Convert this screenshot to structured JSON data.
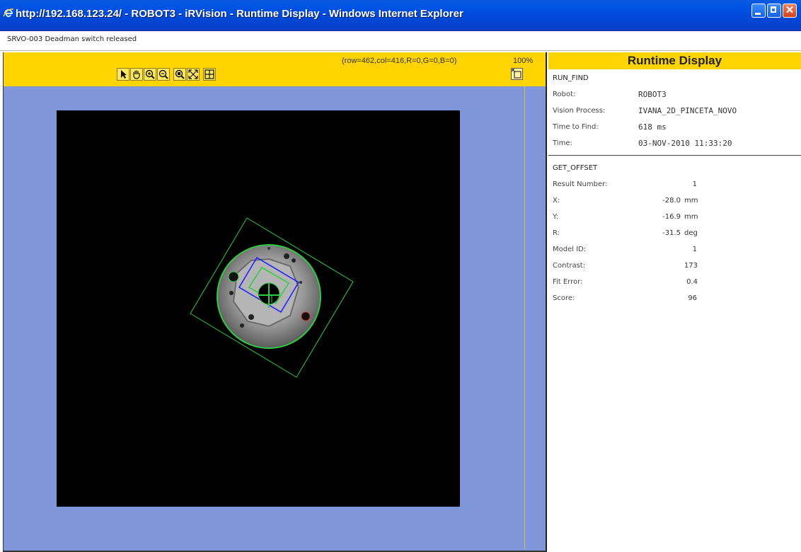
{
  "window": {
    "title": "http://192.168.123.24/ - ROBOT3 - iRVision - Runtime Display - Windows Internet Explorer"
  },
  "status": {
    "message": "SRVO-003 Deadman switch released"
  },
  "image_panel": {
    "coord_readout": "(row=462,col=416,R=0,G=0,B=0)",
    "zoom": "100%",
    "tools": [
      "pointer-icon",
      "pan-hand-icon",
      "zoom-in-icon",
      "zoom-out-icon",
      "zoom-region-icon",
      "fit-to-window-icon",
      "grid-icon"
    ]
  },
  "runtime": {
    "title": "Runtime Display",
    "run_find": {
      "section": "RUN_FIND",
      "rows": [
        {
          "label": "Robot:",
          "value": "ROBOT3"
        },
        {
          "label": "Vision Process:",
          "value": "IVANA_2D_PINCETA_NOVO"
        },
        {
          "label": "Time to Find:",
          "value": "618 ms"
        },
        {
          "label": "Time:",
          "value": "03-NOV-2010 11:33:20"
        }
      ]
    },
    "get_offset": {
      "section": "GET_OFFSET",
      "rows": [
        {
          "label": "Result Number:",
          "value": "1",
          "unit": ""
        },
        {
          "label": "X:",
          "value": "-28.0",
          "unit": "mm"
        },
        {
          "label": "Y:",
          "value": "-16.9",
          "unit": "mm"
        },
        {
          "label": "R:",
          "value": "-31.5",
          "unit": "deg"
        },
        {
          "label": "Model ID:",
          "value": "1",
          "unit": ""
        },
        {
          "label": "Contrast:",
          "value": "173",
          "unit": ""
        },
        {
          "label": "Fit Error:",
          "value": "0.4",
          "unit": ""
        },
        {
          "label": "Score:",
          "value": "96",
          "unit": ""
        }
      ]
    }
  },
  "colors": {
    "toolbar_yellow": "#ffd400",
    "panel_blue": "#7f96da",
    "overlay_green": "#2ecc40",
    "overlay_blue": "#1a1aff"
  }
}
